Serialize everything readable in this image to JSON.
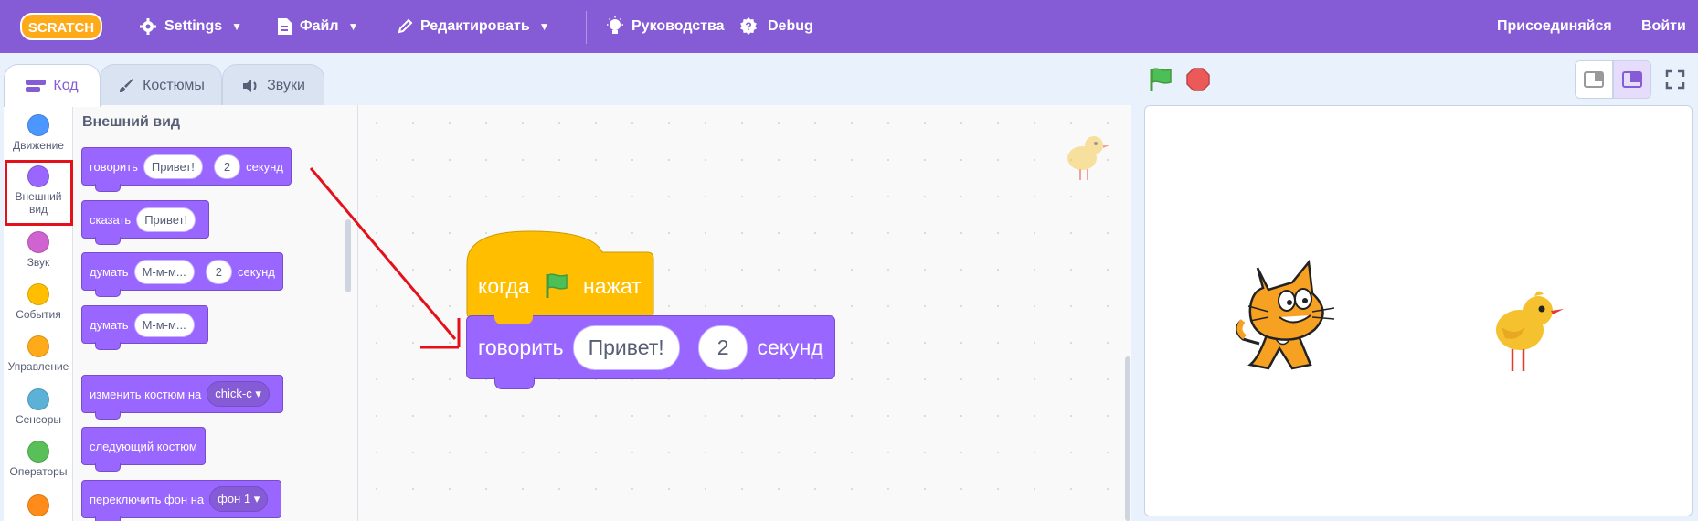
{
  "menubar": {
    "logo_text": "SCRATCH",
    "settings": "Settings",
    "file": "Файл",
    "edit": "Редактировать",
    "tutorials": "Руководства",
    "debug": "Debug",
    "join": "Присоединяйся",
    "signin": "Войти",
    "bg_color": "#855cd6"
  },
  "tabs": {
    "code": "Код",
    "costumes": "Костюмы",
    "sounds": "Звуки"
  },
  "categories": [
    {
      "label": "Движение",
      "color": "#4c97ff"
    },
    {
      "label": "Внешний вид",
      "color": "#9966ff"
    },
    {
      "label": "Звук",
      "color": "#cf63cf"
    },
    {
      "label": "События",
      "color": "#ffbf00"
    },
    {
      "label": "Управление",
      "color": "#ffab19"
    },
    {
      "label": "Сенсоры",
      "color": "#5cb1d6"
    },
    {
      "label": "Операторы",
      "color": "#59c059"
    },
    {
      "label": "",
      "color": "#ff8c1a"
    }
  ],
  "palette": {
    "title": "Внешний вид",
    "say_for": {
      "verb": "говорить",
      "text": "Привет!",
      "secs": "2",
      "unit": "секунд"
    },
    "say": {
      "verb": "сказать",
      "text": "Привет!"
    },
    "think_for": {
      "verb": "думать",
      "text": "М-м-м...",
      "secs": "2",
      "unit": "секунд"
    },
    "think": {
      "verb": "думать",
      "text": "М-м-м..."
    },
    "switch_costume": {
      "verb": "изменить костюм на",
      "value": "chick-c"
    },
    "next_costume": {
      "verb": "следующий костюм"
    },
    "switch_backdrop": {
      "verb": "переключить фон на",
      "value": "фон 1"
    }
  },
  "script": {
    "hat": {
      "pre": "когда",
      "post": "нажат"
    },
    "say": {
      "verb": "говорить",
      "text": "Привет!",
      "secs": "2",
      "unit": "секунд"
    }
  },
  "colors": {
    "looks": "#9966ff",
    "events": "#ffbf00",
    "highlight": "#e4111b"
  },
  "icons": [
    "gear-icon",
    "file-icon",
    "pencil-icon",
    "lightbulb-icon",
    "debug-icon",
    "code-icon",
    "brush-icon",
    "speaker-icon",
    "green-flag-icon",
    "stop-icon",
    "small-stage-icon",
    "large-stage-icon",
    "fullscreen-icon"
  ]
}
